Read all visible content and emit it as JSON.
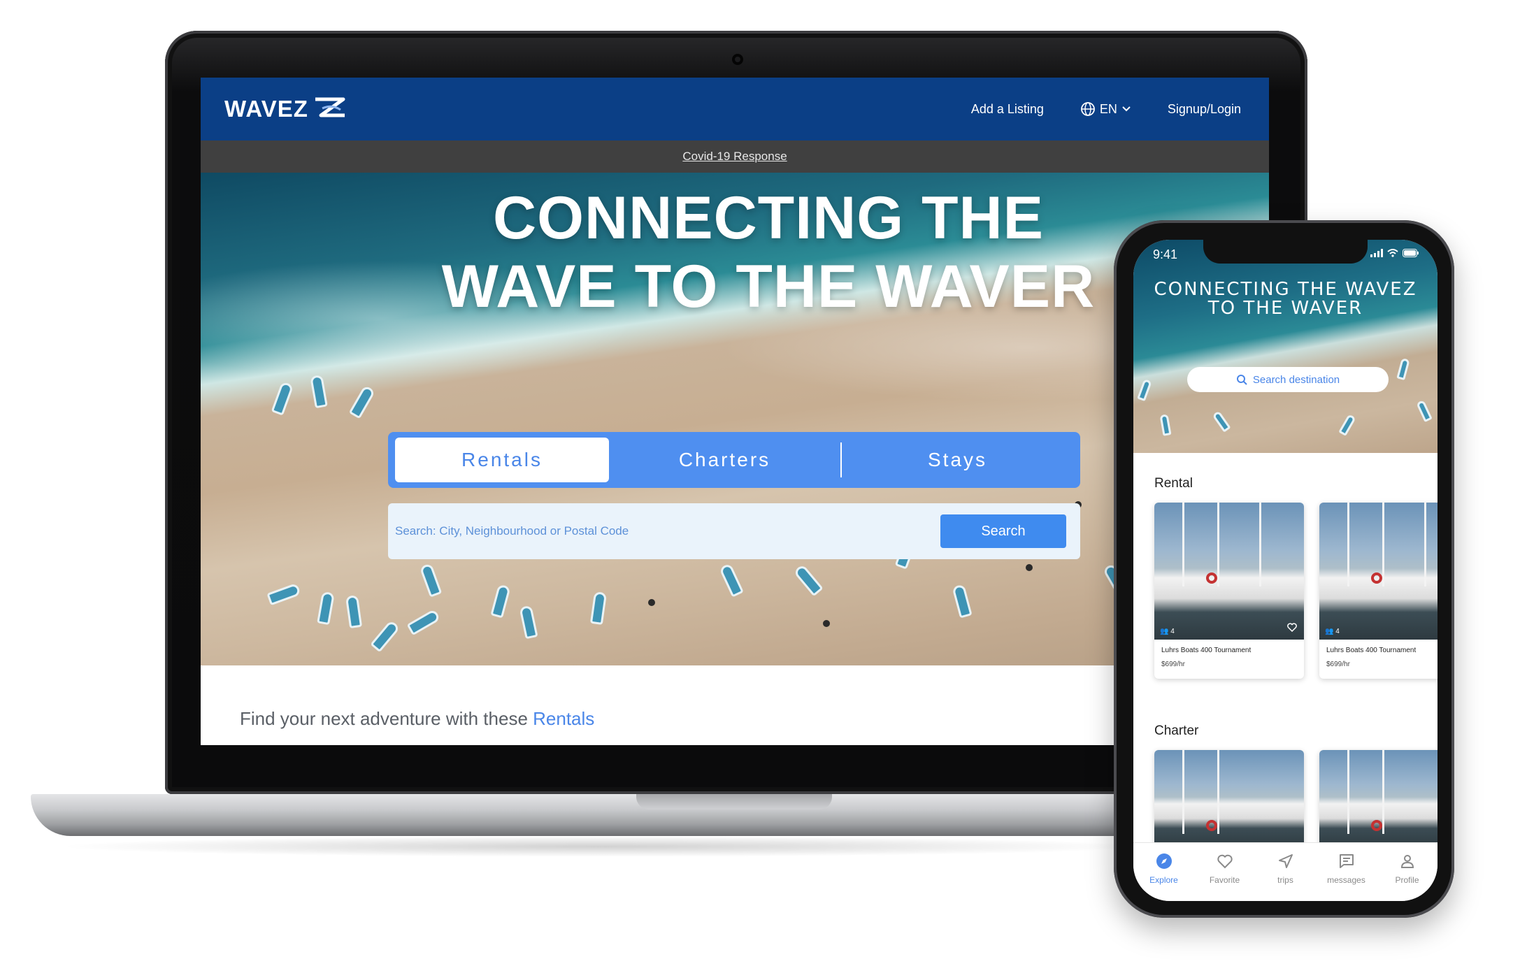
{
  "desktop": {
    "logo": "WAVEZ",
    "nav": {
      "add_listing": "Add a Listing",
      "language": "EN",
      "signup": "Signup/Login"
    },
    "covid_link": "Covid-19 Response",
    "hero_title_line1": "CONNECTING THE",
    "hero_title_line2": "WAVE TO THE WAVER",
    "tabs": [
      {
        "label": "Rentals",
        "active": true
      },
      {
        "label": "Charters",
        "active": false
      },
      {
        "label": "Stays",
        "active": false
      }
    ],
    "search": {
      "placeholder": "Search: City, Neighbourhood or Postal Code",
      "button": "Search"
    },
    "find_text": "Find your next adventure with these",
    "find_accent": "Rentals"
  },
  "mobile": {
    "status_time": "9:41",
    "hero_title_line1": "CONNECTING THE WAVEZ",
    "hero_title_line2": "TO THE WAVER",
    "search_placeholder": "Search destination",
    "sections": [
      {
        "title": "Rental",
        "cards": [
          {
            "name": "Luhrs Boats 400 Tournament",
            "price": "$699/hr",
            "guests": "4"
          },
          {
            "name": "Luhrs Boats 400 Tournament",
            "price": "$699/hr",
            "guests": "4"
          }
        ]
      },
      {
        "title": "Charter",
        "cards": []
      }
    ],
    "tabbar": [
      {
        "label": "Explore",
        "icon": "compass-icon",
        "active": true
      },
      {
        "label": "Favorite",
        "icon": "heart-icon",
        "active": false
      },
      {
        "label": "trips",
        "icon": "send-icon",
        "active": false
      },
      {
        "label": "messages",
        "icon": "message-icon",
        "active": false
      },
      {
        "label": "Profile",
        "icon": "user-icon",
        "active": false
      }
    ]
  },
  "colors": {
    "nav_blue": "#0b3f86",
    "accent_blue": "#4a86e8",
    "tab_blue": "#4f8ff0",
    "search_button": "#3f8bef"
  }
}
